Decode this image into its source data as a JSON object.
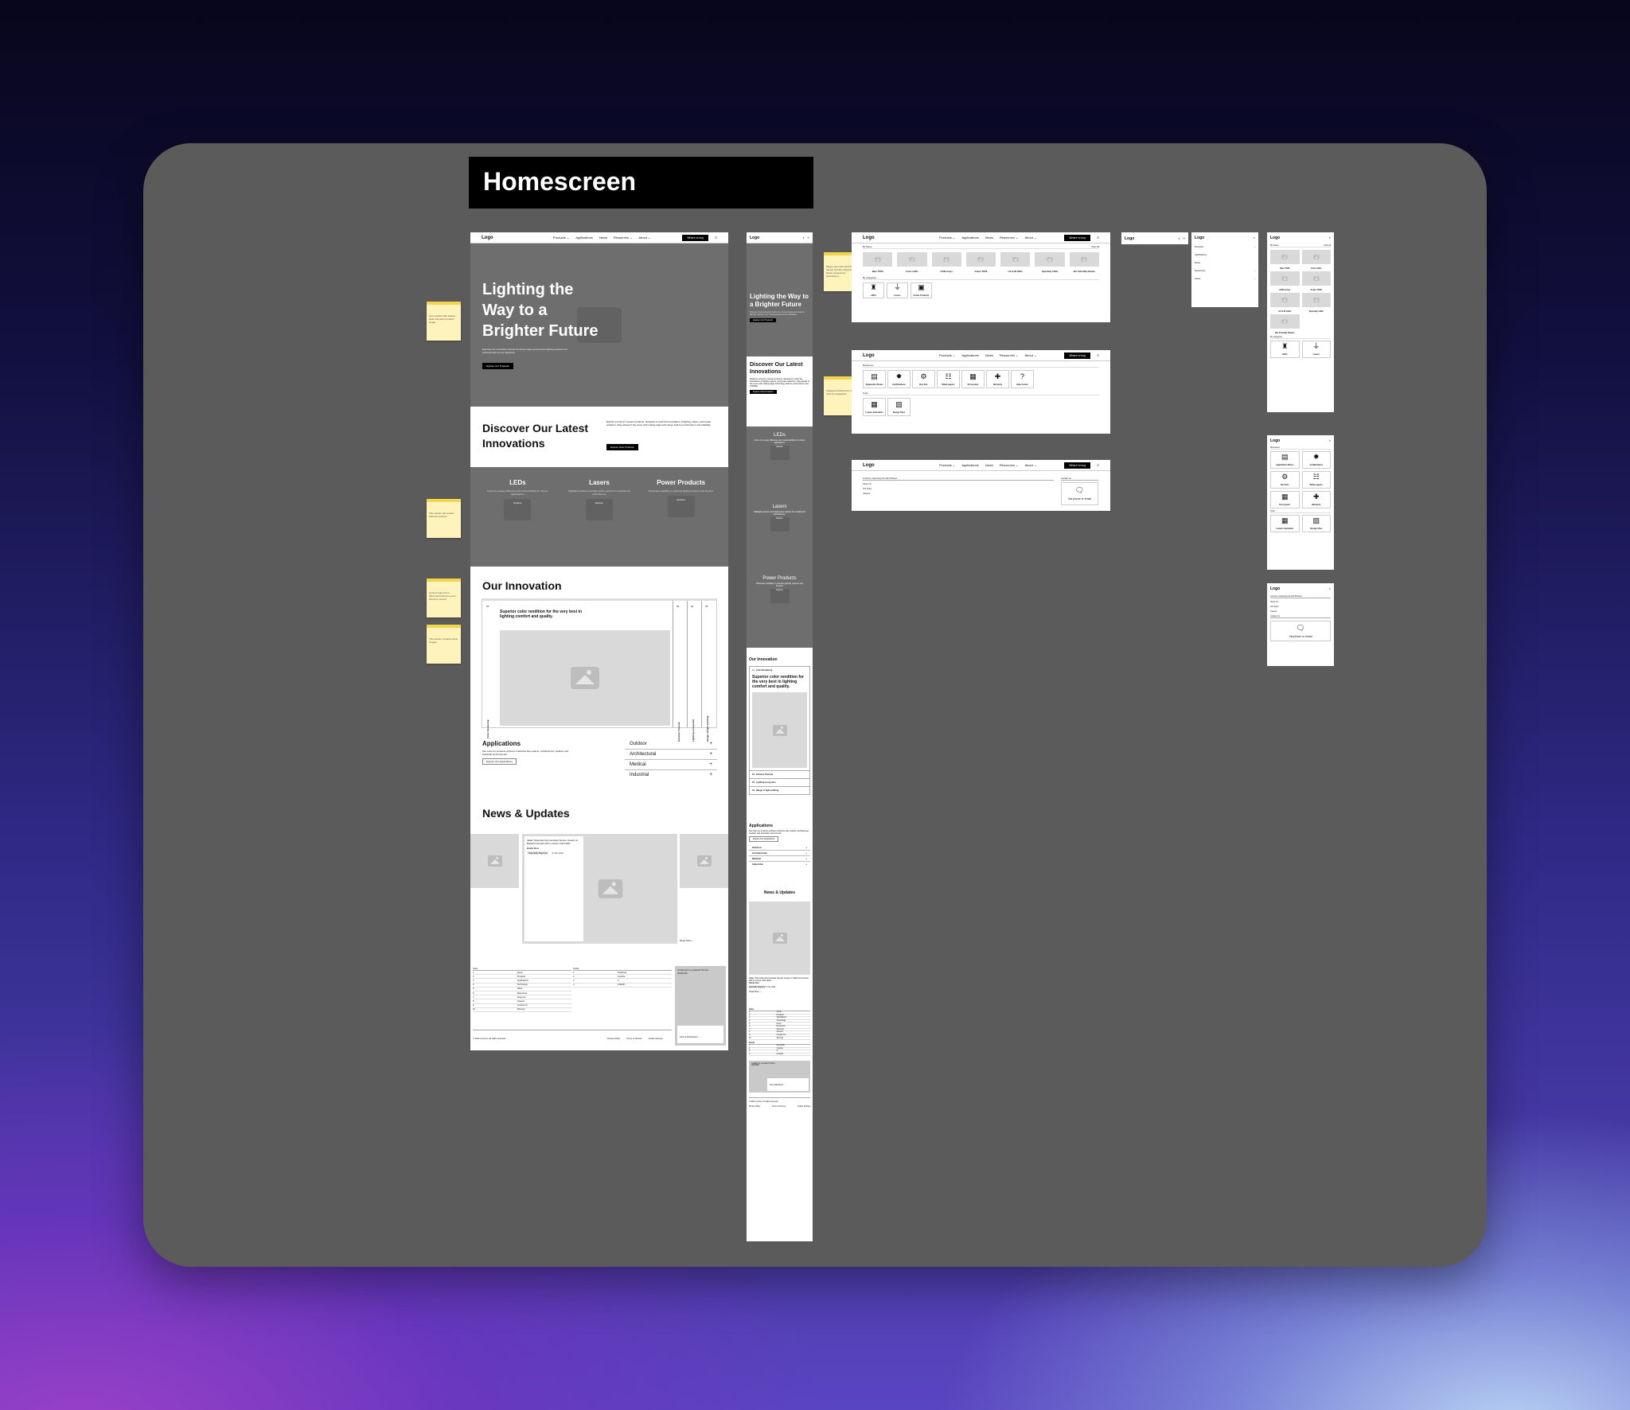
{
  "board_title": "Homescreen",
  "stickies": [
    "Hero section with feature - clear and direct product image",
    "This section will contain featured sections",
    "Content taken from https://www.luminus.com/ structure reused",
    "This section contains stock images"
  ],
  "mega_stickies": [
    "Mega menu with product names and the categories below, grouped by subcategory",
    "Categorize Resources and tools by subgraphic"
  ],
  "nav": {
    "logo": "Logo",
    "links": [
      "Products ⌄",
      "Applications",
      "News",
      "Resources ⌄",
      "About ⌄"
    ],
    "cta": "Where to buy",
    "search_icon": "search-icon",
    "menu_icon": "hamburger-icon",
    "close": "×"
  },
  "hero": {
    "title": "Lighting the Way to a Brighter Future",
    "desc": "Discover the innovation behind Luminus's high-performance lighting solutions for professionals across industries.",
    "button": "Explore Our Products"
  },
  "discover": {
    "title": "Discover Our Latest Innovations",
    "desc": "Explore Luminus's newest products, designed to push the boundaries of lighting, lasers, and power solutions. Stay ahead of the curve with cutting-edge technology built for performance and reliability.",
    "button": "Explore New Products"
  },
  "categories": [
    {
      "title": "LEDs",
      "desc": "Focus on energy efficiency and customizability for various applications.",
      "button": "Explore"
    },
    {
      "title": "Lasers",
      "desc": "Highlight precision and high-power options for medical and industrial use.",
      "button": "Explore"
    },
    {
      "title": "Power Products",
      "desc": "Showcase reliability in powering lighting systems and beyond.",
      "button": "Explore"
    }
  ],
  "innovation": {
    "title": "Our Innovation",
    "active_num": "01",
    "active_label": "Color Rendering",
    "active_text": "Superior color rendition for the very best in lighting comfort and quality.",
    "tabs": [
      {
        "num": "02",
        "label": "Extreme Thermal"
      },
      {
        "num": "03",
        "label": "Lighting ecosystem"
      },
      {
        "num": "04",
        "label": "Range of light emitting"
      }
    ]
  },
  "applications": {
    "title": "Applications",
    "desc": "See how our products enhance industries like outdoor, architectural, medical, and industrial environments.",
    "button": "Explore Our Applications",
    "items": [
      "Outdoor",
      "Architectural",
      "Medical",
      "Industrial"
    ],
    "expand": "+"
  },
  "news": {
    "title": "News & Updates",
    "headline": "Italian Scientists Demonstrate Severe Impact on Bacteria Growth with Luminus UVA LEDs",
    "author": "Kevin Hsu",
    "tag": "Scientific Reports",
    "read_time": "3 min read",
    "read_more": "Read More →"
  },
  "footer": {
    "index_title": "Index",
    "index": [
      "Home",
      "Products",
      "Applications",
      "Technology",
      "News",
      "Resources",
      "About Us",
      "Careers",
      "Contact Us",
      "Sitemap"
    ],
    "social_title": "Social",
    "social": [
      "Facebook",
      "Youtube",
      "X",
      "LinkedIn"
    ],
    "distributor_text": "Looking for a product? Find a distributor",
    "distributor_button": "Find a Distributor →",
    "copyright": "© 2024 Luminus. All rights reserved.",
    "legal": [
      "Privacy Policy",
      "Terms of Service",
      "Cookie Settings"
    ]
  },
  "products_menu": {
    "by_name": "By Name",
    "view_all": "View All",
    "names": [
      "Blue TO56",
      "Color LEDs",
      "COB arrays",
      "Green TO56",
      "UV & IR LEDs",
      "Specialty LEDs",
      "SiC Schottky Diodes"
    ],
    "by_category": "By categories",
    "cats": [
      {
        "icon": "led-bulb-icon",
        "label": "LEDs"
      },
      {
        "icon": "laser-icon",
        "label": "Lasers"
      },
      {
        "icon": "battery-icon",
        "label": "Power Products"
      }
    ]
  },
  "resources_menu": {
    "resources": "Resources",
    "items": [
      {
        "icon": "document-icon",
        "label": "Application Notes"
      },
      {
        "icon": "certificate-badge-icon",
        "label": "Certifications"
      },
      {
        "icon": "kit-icon",
        "label": "Dev Kits"
      },
      {
        "icon": "whitepaper-icon",
        "label": "White papers"
      },
      {
        "icon": "grid-icon",
        "label": "Ecosystem"
      },
      {
        "icon": "warranty-hand-icon",
        "label": "Warranty"
      },
      {
        "icon": "help-icon",
        "label": "Help Center"
      }
    ],
    "tools": "Tools",
    "tool_items": [
      {
        "icon": "calculator-icon",
        "label": "Lumen Calculator"
      },
      {
        "icon": "design-file-icon",
        "label": "Design Files"
      }
    ]
  },
  "about_menu": {
    "heading": "Luminus, Improving Life with Photons",
    "links": [
      "About Us",
      "Our Team",
      "Careers"
    ],
    "contact": "Contact Us",
    "contact_card": "Via phone or email"
  },
  "mobile_menu": {
    "items": [
      "Products",
      "Applications",
      "News",
      "Resources",
      "About"
    ],
    "chev": "›"
  }
}
